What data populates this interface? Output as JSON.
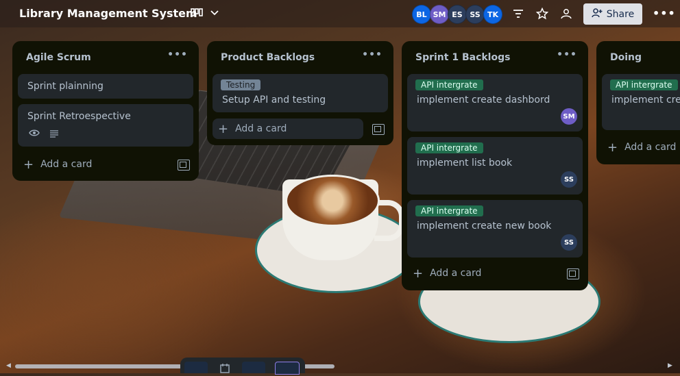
{
  "board": {
    "title": "Library Management System",
    "view_icon": "board-icon",
    "chevron": "chevron-down-icon"
  },
  "members": [
    {
      "initials": "BL",
      "color": "#0c66e4"
    },
    {
      "initials": "SM",
      "color": "#6e5dc6"
    },
    {
      "initials": "ES",
      "color": "#2c3e5d"
    },
    {
      "initials": "SS",
      "color": "#2c3e5d"
    },
    {
      "initials": "TK",
      "color": "#0c66e4"
    }
  ],
  "toolbar": {
    "share_label": "Share"
  },
  "lists": [
    {
      "title": "Agile Scrum",
      "cards": [
        {
          "title": "Sprint plainning"
        },
        {
          "title": "Sprint Retroespective",
          "badges": [
            "eye-icon",
            "description-icon"
          ]
        }
      ],
      "add_label": "Add a card"
    },
    {
      "title": "Product Backlogs",
      "cards": [
        {
          "label": "Testing",
          "title": "Setup API and testing"
        }
      ],
      "add_label": "Add a card"
    },
    {
      "title": "Sprint 1 Backlogs",
      "cards": [
        {
          "label": "API intergrate",
          "title": "implement create dashbord",
          "member": "SM",
          "member_color": "#6e5dc6"
        },
        {
          "label": "API intergrate",
          "title": "implement list book",
          "member": "SS",
          "member_color": "#2c3e5d"
        },
        {
          "label": "API intergrate",
          "title": "implement create new book",
          "member": "SS",
          "member_color": "#2c3e5d"
        }
      ],
      "add_label": "Add a card"
    },
    {
      "title": "Doing",
      "cards": [
        {
          "label": "API intergrate",
          "title": "implement cre"
        }
      ],
      "add_label": "Add a card"
    }
  ],
  "colors": {
    "list_bg": "#101204",
    "card_bg": "#22272b",
    "label_green": "#216e4e",
    "label_gray": "#738496"
  }
}
